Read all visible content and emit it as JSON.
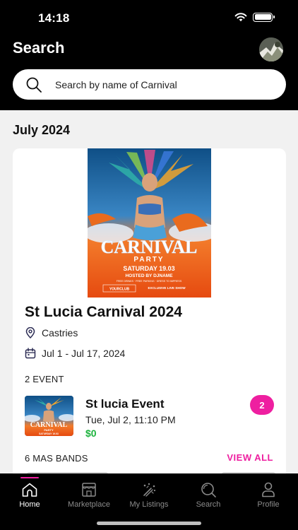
{
  "status_bar": {
    "time": "14:18"
  },
  "header": {
    "title": "Search"
  },
  "search": {
    "placeholder": "Search by name of Carnival"
  },
  "section": {
    "month": "July 2024"
  },
  "carnival": {
    "poster_text": {
      "headline": "CARNIVAL",
      "subhead": "PARTY",
      "date_line": "SATURDAY 19.03",
      "host_line": "HOSTED BY DJNAME",
      "small_line": "FREE DRINKS · FREE PARKING · DRESS TO IMPRESS",
      "club": "YOURCLUB",
      "exclusive": "EXCLUSIVE LIVE SHOW"
    },
    "name": "St Lucia Carnival 2024",
    "location": "Castries",
    "dates": "Jul 1 - Jul 17, 2024",
    "event_count_label": "2 EVENT",
    "event": {
      "name": "St lucia Event",
      "datetime": "Tue, Jul 2, 11:10 PM",
      "price": "$0",
      "badge": "2"
    },
    "bands_label": "6 MAS BANDS",
    "view_all": "VIEW ALL"
  },
  "tabs": [
    {
      "label": "Home",
      "icon": "home-icon",
      "active": true
    },
    {
      "label": "Marketplace",
      "icon": "store-icon",
      "active": false
    },
    {
      "label": "My Listings",
      "icon": "listings-icon",
      "active": false
    },
    {
      "label": "Search",
      "icon": "search-icon",
      "active": false
    },
    {
      "label": "Profile",
      "icon": "person-icon",
      "active": false
    }
  ],
  "colors": {
    "accent": "#ee1fa0",
    "price": "#1db33e",
    "header_bg": "#000000"
  }
}
